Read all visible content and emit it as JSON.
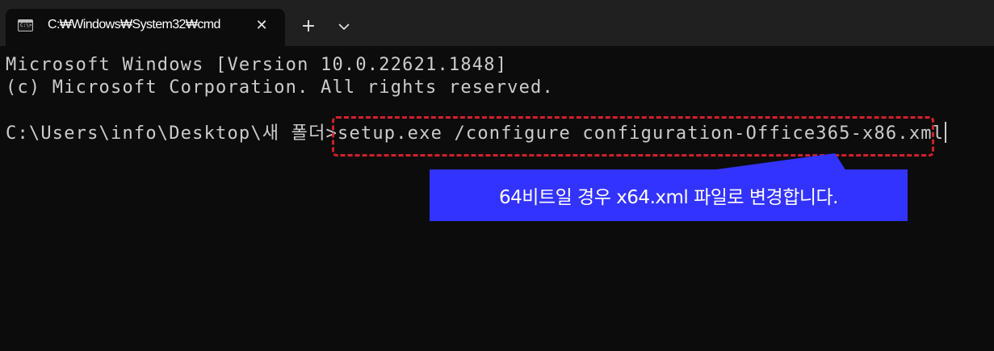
{
  "tab": {
    "title": "C:₩Windows₩System32₩cmd",
    "icon": "terminal-icon",
    "icon_glyph": "C:\\>"
  },
  "tabbar": {
    "close_icon": "close-icon",
    "close_glyph": "✕",
    "new_tab_icon": "plus-icon",
    "new_tab_glyph": "+",
    "dropdown_icon": "chevron-down-icon"
  },
  "console": {
    "lines": [
      "Microsoft Windows [Version 10.0.22621.1848]",
      "(c) Microsoft Corporation. All rights reserved."
    ],
    "prompt": "C:\\Users\\info\\Desktop\\새 폴더>",
    "command": "setup.exe /configure configuration-Office365-x86.xml"
  },
  "annotation": {
    "callout_text": "64비트일 경우 x64.xml 파일로 변경합니다.",
    "callout_color": "#3333ff",
    "highlight_color": "#d0202a"
  },
  "colors": {
    "background": "#0c0c0c",
    "tabbar": "#202020",
    "text": "#cccccc"
  }
}
